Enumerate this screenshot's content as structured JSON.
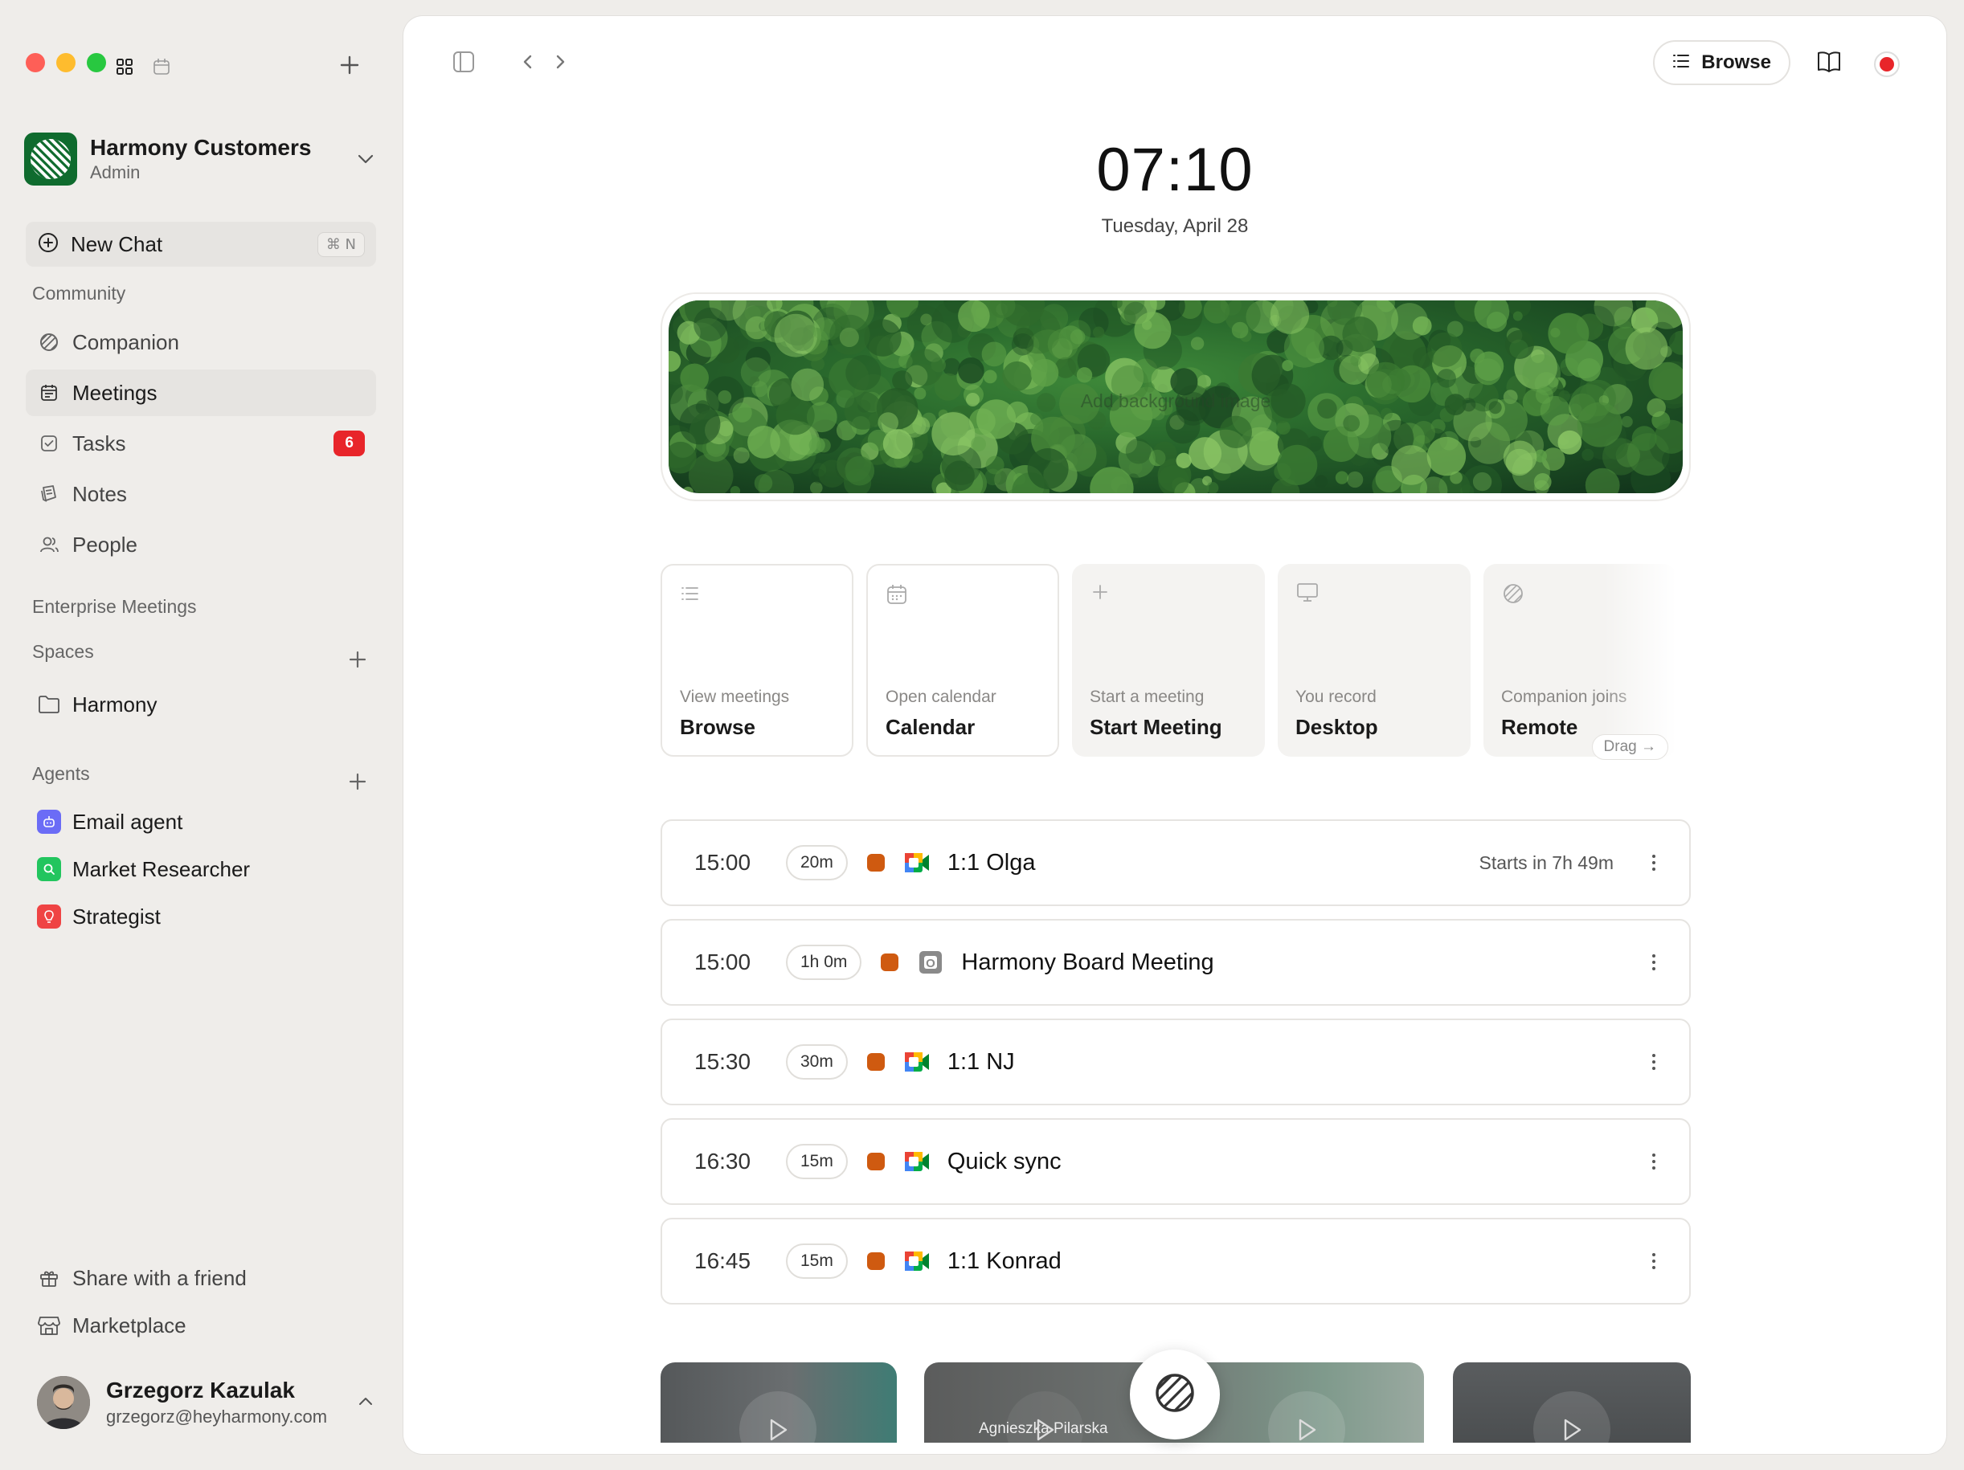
{
  "window": {
    "title": "Harmony"
  },
  "workspace": {
    "name": "Harmony Customers",
    "role": "Admin"
  },
  "new_chat": {
    "label": "New Chat",
    "shortcut": "⌘ N"
  },
  "sidebar": {
    "community_label": "Community",
    "community_items": [
      {
        "label": "Companion",
        "icon": "companion-icon"
      },
      {
        "label": "Meetings",
        "icon": "calendar-icon",
        "active": true
      },
      {
        "label": "Tasks",
        "icon": "checkbox-icon",
        "badge": "6"
      },
      {
        "label": "Notes",
        "icon": "notes-icon"
      },
      {
        "label": "People",
        "icon": "people-icon"
      }
    ],
    "enterprise_label": "Enterprise Meetings",
    "spaces_label": "Spaces",
    "spaces": [
      {
        "label": "Harmony",
        "icon": "folder-icon"
      }
    ],
    "agents_label": "Agents",
    "agents": [
      {
        "label": "Email agent",
        "color": "#6b6cf6"
      },
      {
        "label": "Market Researcher",
        "color": "#22c55e"
      },
      {
        "label": "Strategist",
        "color": "#ef4444"
      }
    ],
    "share_label": "Share with a friend",
    "marketplace_label": "Marketplace"
  },
  "user": {
    "name": "Grzegorz Kazulak",
    "email": "grzegorz@heyharmony.com"
  },
  "toolbar": {
    "browse_label": "Browse"
  },
  "clock": {
    "time": "07:10",
    "date": "Tuesday, April 28"
  },
  "hero": {
    "label": "Add background image"
  },
  "quick_actions": [
    {
      "sub": "View meetings",
      "title": "Browse",
      "icon": "list-icon",
      "style": "outline"
    },
    {
      "sub": "Open calendar",
      "title": "Calendar",
      "icon": "calendar-icon",
      "style": "outline"
    },
    {
      "sub": "Start a meeting",
      "title": "Start Meeting",
      "icon": "plus-icon",
      "style": "filled"
    },
    {
      "sub": "You record",
      "title": "Desktop",
      "icon": "monitor-icon",
      "style": "filled"
    },
    {
      "sub": "Companion joins",
      "title": "Remote",
      "icon": "companion-icon",
      "style": "filled",
      "pill": "Drag →"
    }
  ],
  "meetings": [
    {
      "time": "15:00",
      "duration": "20m",
      "title": "1:1 Olga",
      "app": "google-meet-icon",
      "status": "Starts in 7h 49m"
    },
    {
      "time": "15:00",
      "duration": "1h 0m",
      "title": "Harmony Board Meeting",
      "app": "outlook-icon",
      "status": ""
    },
    {
      "time": "15:30",
      "duration": "30m",
      "title": "1:1 NJ",
      "app": "google-meet-icon",
      "status": ""
    },
    {
      "time": "16:30",
      "duration": "15m",
      "title": "Quick sync",
      "app": "google-meet-icon",
      "status": ""
    },
    {
      "time": "16:45",
      "duration": "15m",
      "title": "1:1 Konrad",
      "app": "google-meet-icon",
      "status": ""
    }
  ],
  "recordings": [
    {
      "name": ""
    },
    {
      "name": "Agnieszka Pilarska"
    },
    {
      "name": ""
    }
  ],
  "colors": {
    "accent_red": "#e8252a",
    "meeting_dot": "#cf5a10",
    "brand_green": "#0f6b2e"
  }
}
